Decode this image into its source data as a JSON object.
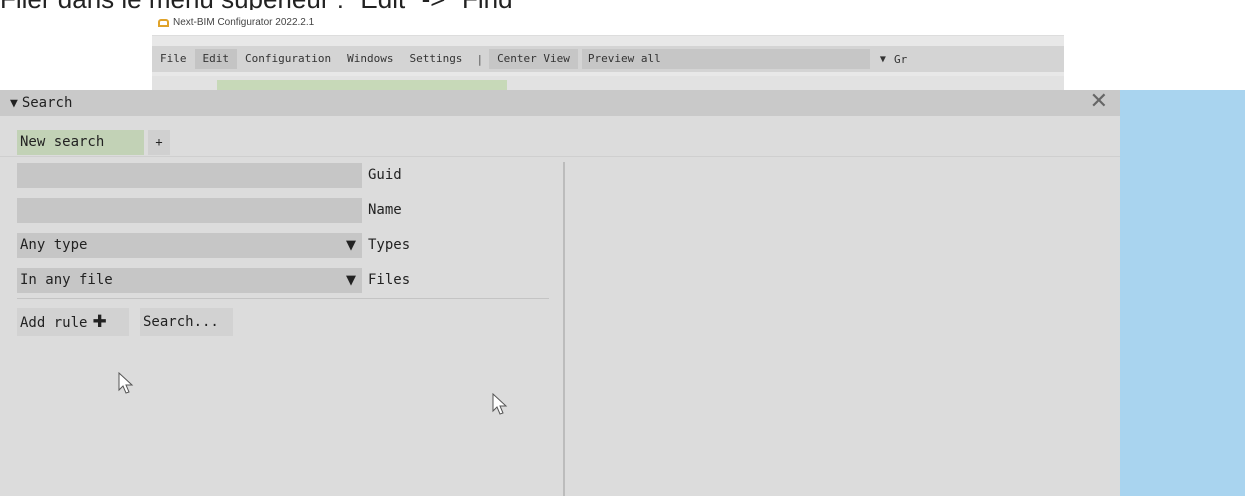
{
  "caption": "Filer dans le menu supérieur : \"Edit\" -> \"Find\"",
  "background_app": {
    "title": "Next-BIM Configurator 2022.2.1",
    "menu": [
      "File",
      "Edit",
      "Configuration",
      "Windows",
      "Settings"
    ],
    "separator": "|",
    "center_view": "Center View",
    "preview": "Preview all",
    "clipped": "Gr"
  },
  "search_panel": {
    "title": "Search",
    "toggle_glyph": "▼",
    "close_glyph": "✕",
    "tabs": {
      "active": "New search",
      "add": "+"
    },
    "fields": {
      "guid_label": "Guid",
      "guid_value": "",
      "name_label": "Name",
      "name_value": "",
      "types_value": "Any type",
      "types_label": "Types",
      "files_value": "In any file",
      "files_label": "Files"
    },
    "buttons": {
      "add_rule": "Add rule",
      "search": "Search..."
    }
  },
  "colors": {
    "panel_bg": "#dcdcdc",
    "tab_active": "#c2d2b6",
    "right_area": "#a9d4ef"
  },
  "icons": [
    "app-logo-icon",
    "collapse-triangle-icon",
    "close-icon",
    "dropdown-arrow-icon",
    "plus-icon",
    "mouse-pointer-icon"
  ]
}
